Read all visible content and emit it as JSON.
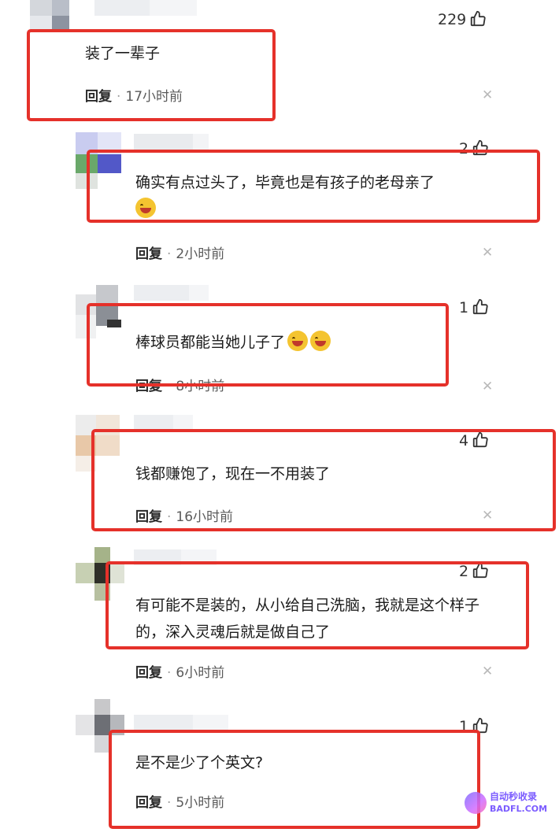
{
  "comments": [
    {
      "text": "装了一辈子",
      "likes": "229",
      "reply_label": "回复",
      "time": "17小时前",
      "emoji": 0
    },
    {
      "text": "确实有点过头了，毕竟也是有孩子的老母亲了",
      "likes": "2",
      "reply_label": "回复",
      "time": "2小时前",
      "emoji": 1
    },
    {
      "text": "棒球员都能当她儿子了",
      "likes": "1",
      "reply_label": "回复",
      "time": "8小时前",
      "emoji": 2
    },
    {
      "text": "钱都赚饱了，现在一不用装了",
      "likes": "4",
      "reply_label": "回复",
      "time": "16小时前",
      "emoji": 0
    },
    {
      "text": "有可能不是装的，从小给自己洗脑，我就是这个样子的，深入灵魂后就是做自己了",
      "likes": "2",
      "reply_label": "回复",
      "time": "6小时前",
      "emoji": 0
    },
    {
      "text": "是不是少了个英文?",
      "likes": "1",
      "reply_label": "回复",
      "time": "5小时前",
      "emoji": 0
    }
  ],
  "icons": {
    "like": "thumbs-up-icon",
    "close": "close-icon",
    "emoji": "laughing-emoji-icon"
  },
  "watermark": {
    "line1": "自动秒收录",
    "line2": "BADFL.COM"
  },
  "colors": {
    "highlight": "#e5312a",
    "watermark": "#7b5cff"
  }
}
